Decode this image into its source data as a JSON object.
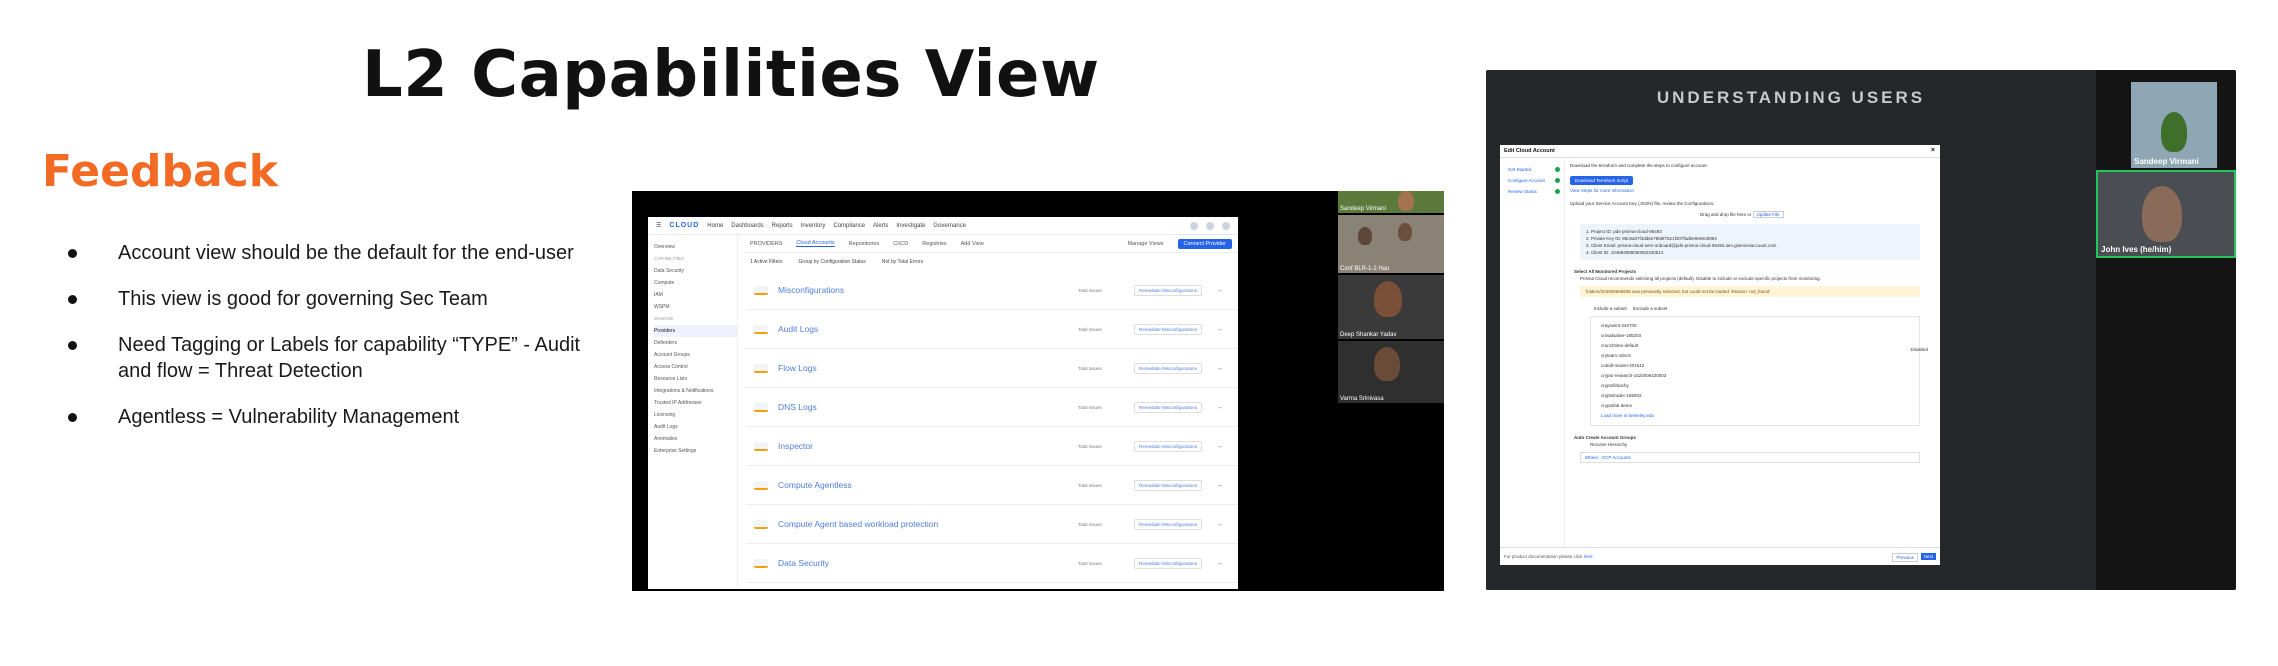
{
  "slide": {
    "title": "L2 Capabilities View",
    "feedback_heading": "Feedback",
    "bullets": [
      "Account view should be the default for the end-user",
      "This view is good for governing Sec Team",
      "Need Tagging or Labels for capability “TYPE” - Audit and flow = Threat Detection",
      "Agentless = Vulnerability Management"
    ]
  },
  "screenshot1": {
    "logo": "CLOUD",
    "nav": [
      "Home",
      "Dashboards",
      "Reports",
      "Inventory",
      "Compliance",
      "Alerts",
      "Investigate",
      "Governance"
    ],
    "sidebar": [
      "Overview",
      "CAPABILITIES",
      "Data Security",
      "Compute",
      "IAM",
      "WSPM",
      "MANAGE",
      "Providers",
      "Defenders",
      "Account Groups",
      "Access Control",
      "Resource Lists",
      "Integrations & Notifications",
      "Trusted IP Addresses",
      "Licensing",
      "Audit Logs",
      "Anomalies",
      "Enterprise Settings"
    ],
    "tabs": [
      "PROVIDERS",
      "Cloud Accounts",
      "Repositories",
      "CI/CD",
      "Registries",
      "Add View"
    ],
    "manage_views": "Manage Views",
    "connect_button": "Connect Provider",
    "filters": [
      "1 Active Filters",
      "Group by Configuration Status",
      "Not by Total Errors"
    ],
    "issues_label": "Total Issues",
    "remediate_label": "Remediate Misconfigurations",
    "rows": [
      "Misconfigurations",
      "Audit Logs",
      "Flow Logs",
      "DNS Logs",
      "Inspector",
      "Compute Agentless",
      "Compute Agent based workload protection",
      "Data Security"
    ],
    "participants": [
      "Sandeep Virmani",
      "Conf BLR-1-2 Hau",
      "Deep Shankar Yadav",
      "Varma Srinivasa"
    ]
  },
  "screenshot2": {
    "banner": "UNDERSTANDING USERS",
    "modal_title": "Edit Cloud Account",
    "steps": [
      "Get Started",
      "Configure Account",
      "Review Status"
    ],
    "download_text": "Download the terraform and complete the steps to configure account.",
    "download_button": "Download Terraform Script",
    "view_steps": "View Steps for more information",
    "upload_text": "Upload your Service Account Key (JSON) file, review the Configurations.",
    "drag_text": "Drag and drop file here or",
    "update_file": "Update File",
    "info": [
      "1. Project ID:   pds-prisma-cloud-95493",
      "2. Private Key ID:   85c5a07f4dd6e7859f7521f307fad0e90e5c9084",
      "3. Client Email:   prisma-cloud-serv-onboard@pds-prisma-cloud-95493.iam.gserviceaccount.com",
      "4. Client ID:   104884088060062340514"
    ],
    "select_projects": "Select All Monitored Projects",
    "disabled": "Disabled",
    "select_desc": "Prisma Cloud recommends selecting all projects (default). Disable to include or exclude specific projects from monitoring.",
    "warning": "folders/104926668938 was previously selected, but could not be loaded. Reason: not_found",
    "include": "Include a subset",
    "exclude": "Exclude a subset",
    "projects": [
      "crayssimt-240700",
      "crowdsalive-185203",
      "crunchtime-default",
      "cryteam-43ec5",
      "cobalt-maxim-201612",
      "crypto-research-1524006420003",
      "cryptofirkachy",
      "cryptotrader-186502",
      "cryptolab-demo"
    ],
    "load_more": "Load more in berkeley.edu",
    "auto_groups": "Auto Create Account Groups",
    "recurse": "Recurse Hierarchy",
    "gcp_accounts": "Wheel - GCP Accounts",
    "doc_text": "For product documentation please click",
    "doc_link": "here",
    "previous": "Previous",
    "next": "Next",
    "participants": [
      "Sandeep Virmani",
      "John Ives (he/him)"
    ]
  }
}
